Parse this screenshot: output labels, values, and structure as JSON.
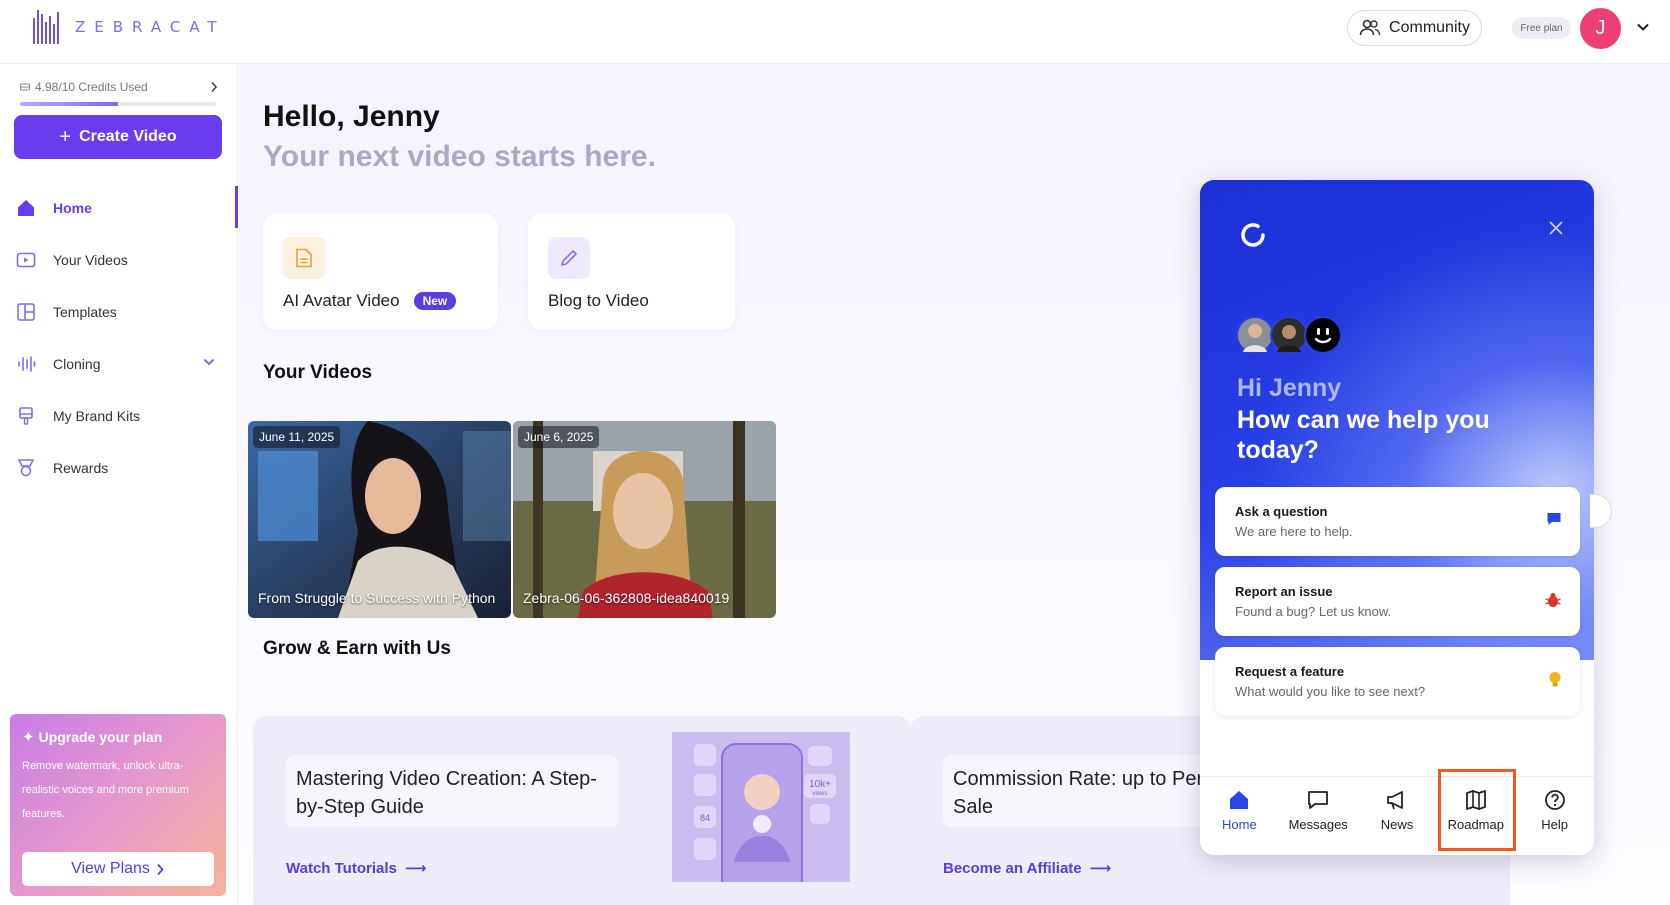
{
  "brand": {
    "name": "ZEBRACAT"
  },
  "topbar": {
    "community_label": "Community",
    "plan_badge": "Free plan",
    "avatar_initial": "J"
  },
  "sidebar": {
    "credits_label": "4.98/10 Credits Used",
    "credits_fraction": 0.498,
    "create_label": "Create Video",
    "nav": [
      {
        "label": "Home",
        "icon": "home-icon",
        "active": true
      },
      {
        "label": "Your Videos",
        "icon": "video-icon",
        "active": false
      },
      {
        "label": "Templates",
        "icon": "templates-icon",
        "active": false
      },
      {
        "label": "Cloning",
        "icon": "waveform-icon",
        "active": false
      },
      {
        "label": "My Brand Kits",
        "icon": "brush-icon",
        "active": false
      },
      {
        "label": "Rewards",
        "icon": "trophy-icon",
        "active": false
      }
    ],
    "upgrade": {
      "title": "Upgrade your plan",
      "text": "Remove watermark, unlock ultra-realistic voices and more premium features.",
      "button": "View Plans"
    }
  },
  "main": {
    "greeting": "Hello, Jenny",
    "tagline": "Your next video starts here.",
    "cards": [
      {
        "label": "AI Avatar Video",
        "badge": "New",
        "icon": "document-icon"
      },
      {
        "label": "Blog to Video",
        "icon": "pencil-icon"
      }
    ],
    "videos_title": "Your Videos",
    "videos": [
      {
        "date": "June 11, 2025",
        "title": "From Struggle to Success with Python"
      },
      {
        "date": "June 6, 2025",
        "title": "Zebra-06-06-362808-idea840019"
      }
    ],
    "grow_title": "Grow & Earn with Us",
    "grow_cards": [
      {
        "title": "Mastering Video Creation: A Step-by-Step Guide",
        "link": "Watch Tutorials"
      },
      {
        "title": "Commission Rate: up to Per Sale",
        "link": "Become an Affiliate"
      }
    ],
    "phone_badges": [
      "10k+",
      "views",
      "84"
    ]
  },
  "widget": {
    "hi": "Hi Jenny",
    "help": "How can we help you today?",
    "options": [
      {
        "title": "Ask a question",
        "subtitle": "We are here to help.",
        "icon": "chat-bubble-icon"
      },
      {
        "title": "Report an issue",
        "subtitle": "Found a bug? Let us know.",
        "icon": "bug-icon"
      },
      {
        "title": "Request a feature",
        "subtitle": "What would you like to see next?",
        "icon": "lightbulb-icon"
      }
    ],
    "tabs": [
      {
        "label": "Home",
        "icon": "home-icon",
        "active": true
      },
      {
        "label": "Messages",
        "icon": "messages-icon"
      },
      {
        "label": "News",
        "icon": "megaphone-icon"
      },
      {
        "label": "Roadmap",
        "icon": "map-icon",
        "highlighted": true
      },
      {
        "label": "Help",
        "icon": "help-icon"
      }
    ]
  },
  "colors": {
    "accent": "#6a3cf0",
    "widget_blue": "#2941e6",
    "highlight": "#f25a1d",
    "avatar": "#ee3f73"
  }
}
